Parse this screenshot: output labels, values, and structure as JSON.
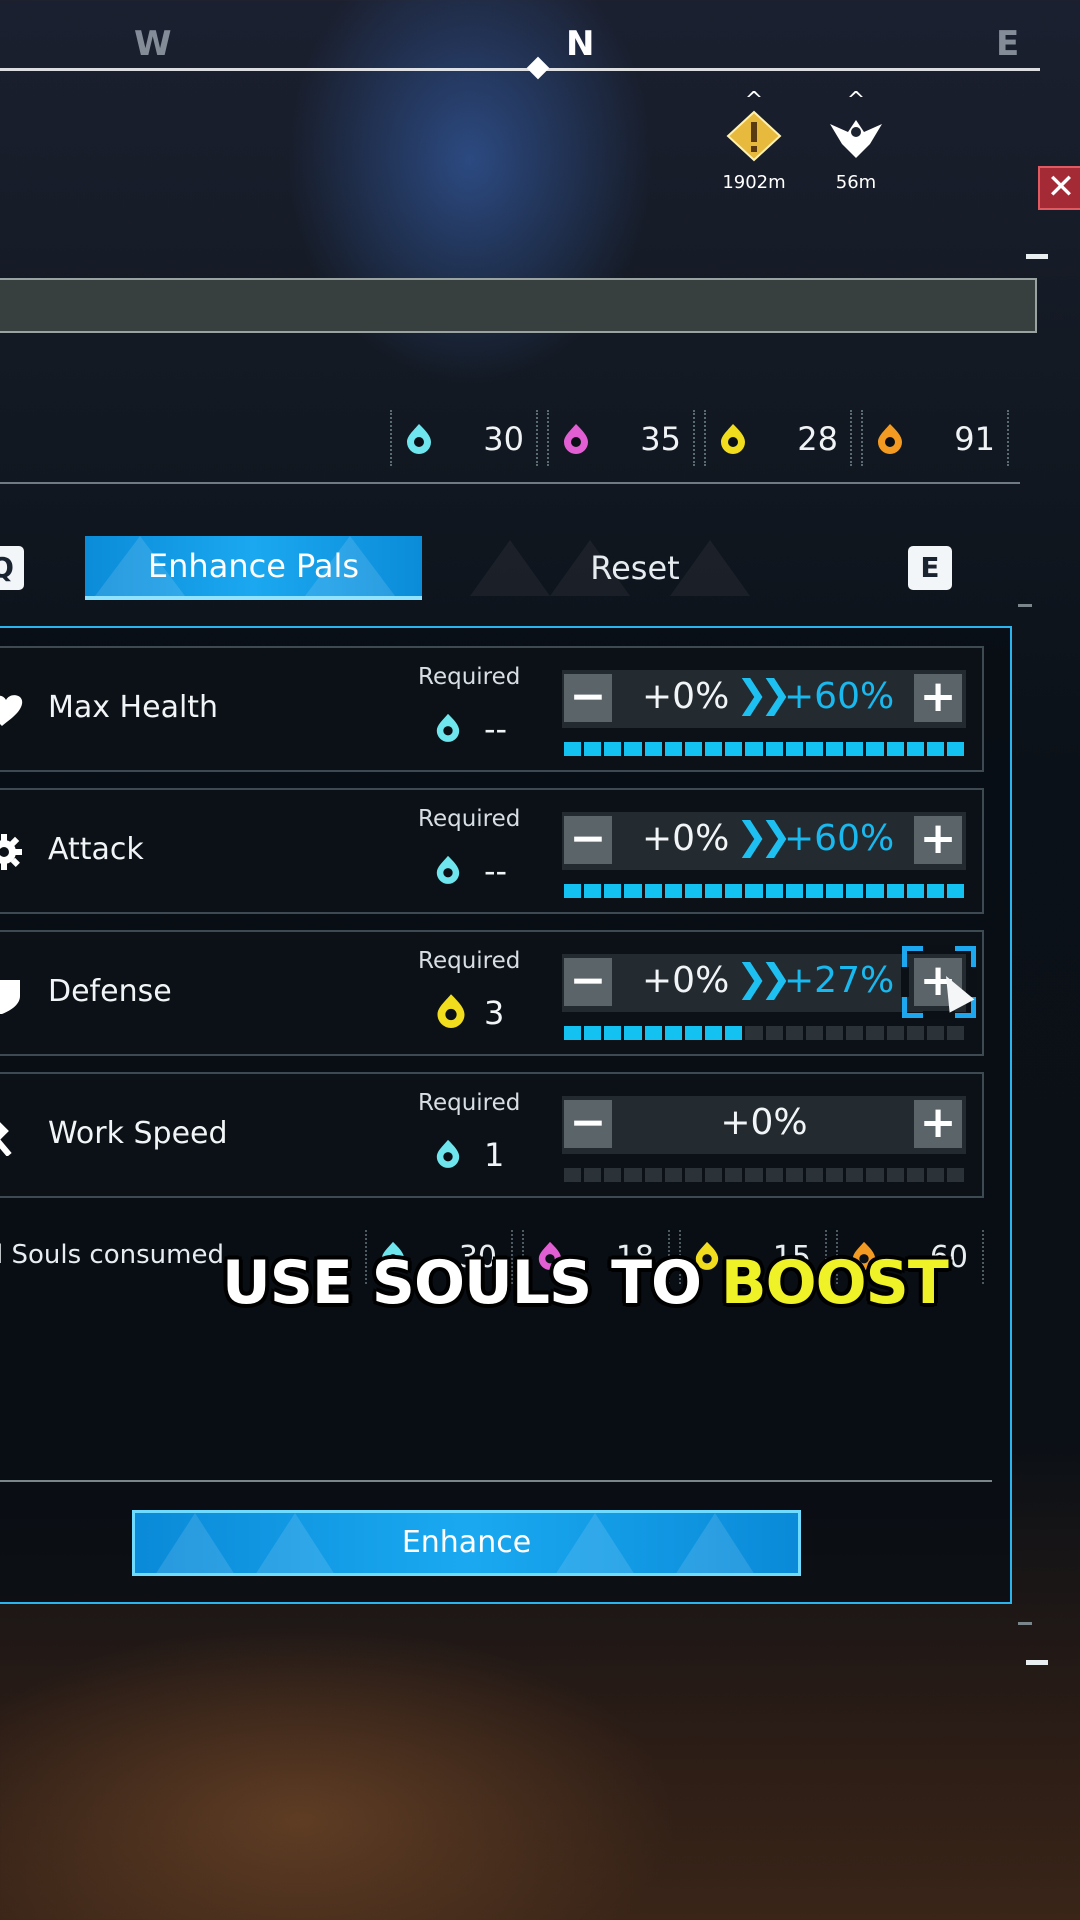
{
  "compass": {
    "west": "W",
    "north": "N",
    "east": "E",
    "markers": [
      {
        "name": "tower-marker",
        "distance": "1902m"
      },
      {
        "name": "eagle-marker",
        "distance": "56m"
      }
    ]
  },
  "souls_inventory": [
    {
      "icon": "cyan-soul-icon",
      "color": "#6fe6ee",
      "value": "30"
    },
    {
      "icon": "pink-soul-icon",
      "color": "#e25fd3",
      "value": "35"
    },
    {
      "icon": "yellow-soul-icon",
      "color": "#f1dc1e",
      "value": "28"
    },
    {
      "icon": "orange-soul-icon",
      "color": "#f29a22",
      "value": "91"
    }
  ],
  "tabs": {
    "left_key": "Q",
    "enhance_label": "Enhance Pals",
    "reset_label": "Reset",
    "right_key": "E"
  },
  "required_label": "Required",
  "stats": [
    {
      "name": "Max Health",
      "icon": "heart-icon",
      "required": "--",
      "soul_color": "#6fe6ee",
      "current": "+0%",
      "target": "+60%",
      "level": 1.0
    },
    {
      "name": "Attack",
      "icon": "gear-icon",
      "required": "--",
      "soul_color": "#6fe6ee",
      "current": "+0%",
      "target": "+60%",
      "level": 1.0
    },
    {
      "name": "Defense",
      "icon": "shield-icon",
      "required": "3",
      "soul_color": "#f1dc1e",
      "current": "+0%",
      "target": "+27%",
      "level": 0.45
    },
    {
      "name": "Work Speed",
      "icon": "hammer-icon",
      "required": "1",
      "soul_color": "#6fe6ee",
      "current": "+0%",
      "target": "",
      "level": 0.0
    }
  ],
  "consumed": {
    "label": "l Souls consumed",
    "values": [
      "30",
      "18",
      "15",
      "60"
    ]
  },
  "caption": {
    "prefix": "USE SOULS TO ",
    "highlight": "BOOST"
  },
  "enhance_button": "Enhance",
  "colors": {
    "accent": "#19b8ee",
    "panel_border": "#2bb5ee"
  }
}
